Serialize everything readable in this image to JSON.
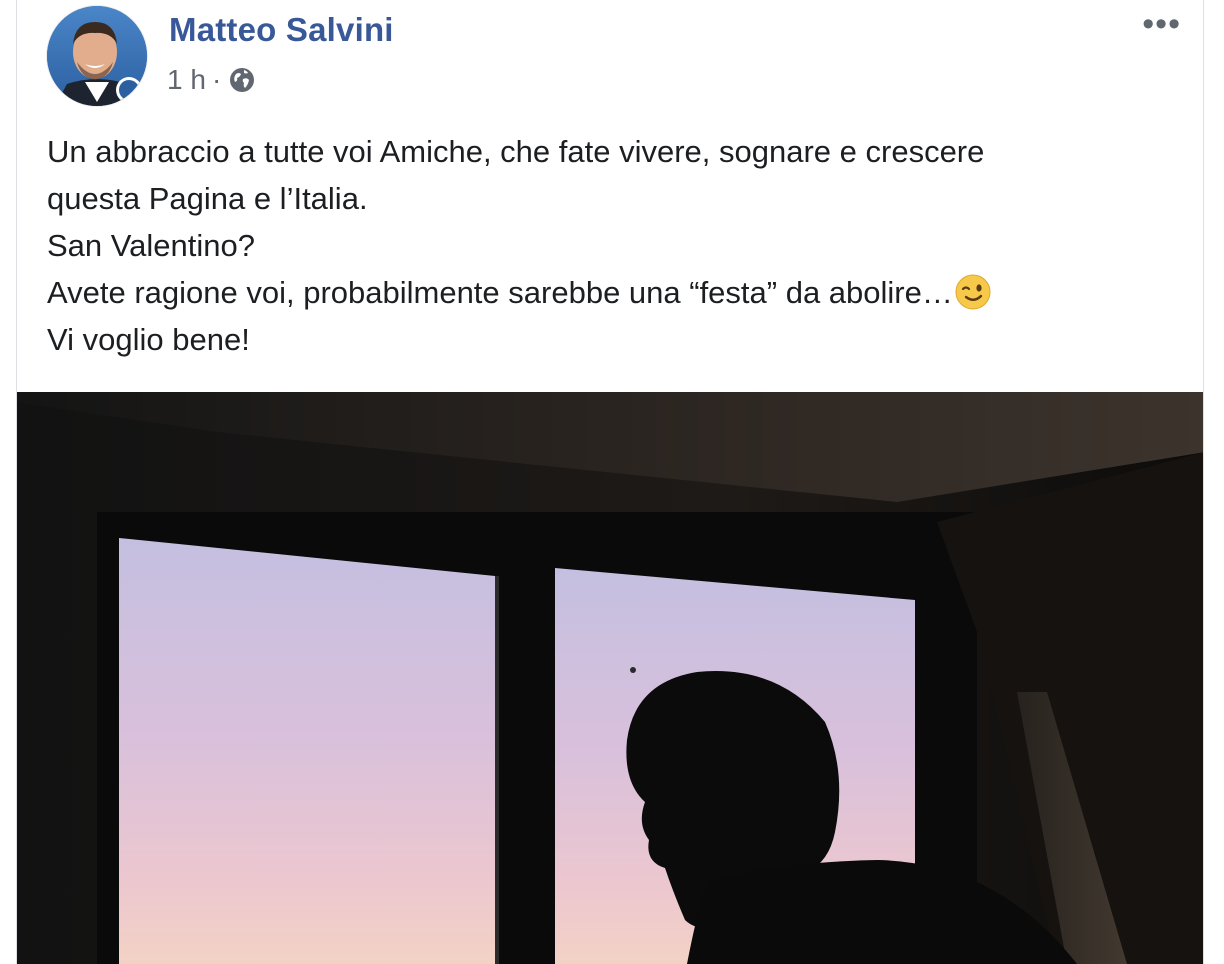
{
  "post": {
    "author_name": "Matteo Salvini",
    "timestamp": "1 h",
    "separator": "·",
    "audience_icon": "globe-icon",
    "more_label": "•••",
    "text_lines": [
      "Un abbraccio a tutte voi Amiche, che fate vivere, sognare e crescere",
      "questa Pagina e l’Italia.",
      "San Valentino?",
      "Avete ragione voi, probabilmente sarebbe una “festa” da abolire…",
      "Vi voglio bene!"
    ],
    "emoji": "winking-face-icon"
  },
  "colors": {
    "author": "#385898",
    "meta": "#606770",
    "text": "#1c1e21",
    "border": "#dddfe2"
  }
}
